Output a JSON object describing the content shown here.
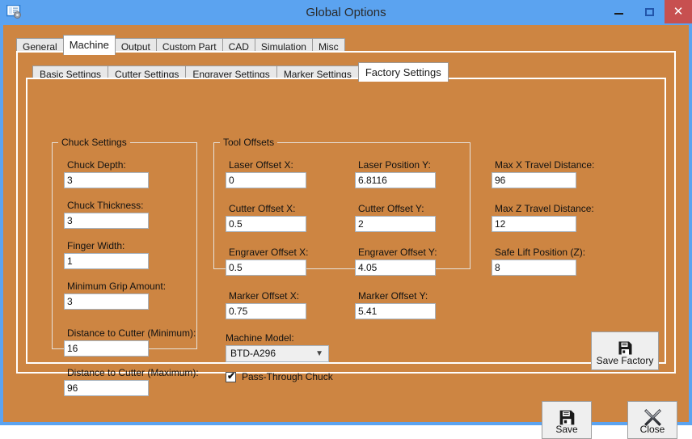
{
  "window": {
    "title": "Global Options",
    "icon": "options-form-gear-icon",
    "controls": {
      "minimize": "minimize-icon",
      "maximize": "maximize-icon",
      "close": "close-icon"
    },
    "colors": {
      "titlebar": "#5BA3F0",
      "client_background": "#CD8542",
      "close_button": "#C75050",
      "panel_border": "#FFFFFF",
      "textbox_background": "#FFFFFF"
    }
  },
  "outer_tabs": [
    {
      "label": "General",
      "active": false
    },
    {
      "label": "Machine",
      "active": true
    },
    {
      "label": "Output",
      "active": false
    },
    {
      "label": "Custom Part",
      "active": false
    },
    {
      "label": "CAD",
      "active": false
    },
    {
      "label": "Simulation",
      "active": false
    },
    {
      "label": "Misc",
      "active": false
    }
  ],
  "inner_tabs": [
    {
      "label": "Basic Settings",
      "active": false
    },
    {
      "label": "Cutter Settings",
      "active": false
    },
    {
      "label": "Engraver Settings",
      "active": false
    },
    {
      "label": "Marker Settings",
      "active": false
    },
    {
      "label": "Factory Settings",
      "active": true
    }
  ],
  "chuck_settings": {
    "title": "Chuck Settings",
    "fields": [
      {
        "label": "Chuck Depth:",
        "value": "3"
      },
      {
        "label": "Chuck Thickness:",
        "value": "3"
      },
      {
        "label": "Finger Width:",
        "value": "1"
      },
      {
        "label": "Minimum Grip Amount:",
        "value": "3"
      },
      {
        "label": "Distance to Cutter (Minimum):",
        "value": "16"
      },
      {
        "label": "Distance to Cutter (Maximum):",
        "value": "96"
      }
    ]
  },
  "tool_offsets": {
    "title": "Tool Offsets",
    "left_fields": [
      {
        "label": "Laser Offset X:",
        "value": "0"
      },
      {
        "label": "Cutter Offset X:",
        "value": "0.5"
      },
      {
        "label": "Engraver Offset X:",
        "value": "0.5"
      },
      {
        "label": "Marker Offset X:",
        "value": "0.75"
      }
    ],
    "right_fields": [
      {
        "label": "Laser Position Y:",
        "value": "6.8116"
      },
      {
        "label": "Cutter Offset Y:",
        "value": "2"
      },
      {
        "label": "Engraver Offset Y:",
        "value": "4.05"
      },
      {
        "label": "Marker Offset Y:",
        "value": "5.41"
      }
    ]
  },
  "travel_settings": {
    "fields": [
      {
        "label": "Max X Travel Distance:",
        "value": "96"
      },
      {
        "label": "Max Z Travel Distance:",
        "value": "12"
      },
      {
        "label": "Safe Lift Position (Z):",
        "value": "8"
      }
    ]
  },
  "machine_model": {
    "label": "Machine Model:",
    "selected": "BTD-A296",
    "arrow_icon": "chevron-down-icon"
  },
  "pass_through_chuck": {
    "label": "Pass-Through Chuck",
    "checked": true,
    "check_glyph": "✔"
  },
  "buttons": {
    "save_factory": {
      "label": "Save Factory",
      "icon": "floppy-disk-save-icon"
    },
    "save": {
      "label": "Save",
      "icon": "floppy-disk-save-icon"
    },
    "close": {
      "label": "Close",
      "icon": "x-close-icon"
    }
  }
}
